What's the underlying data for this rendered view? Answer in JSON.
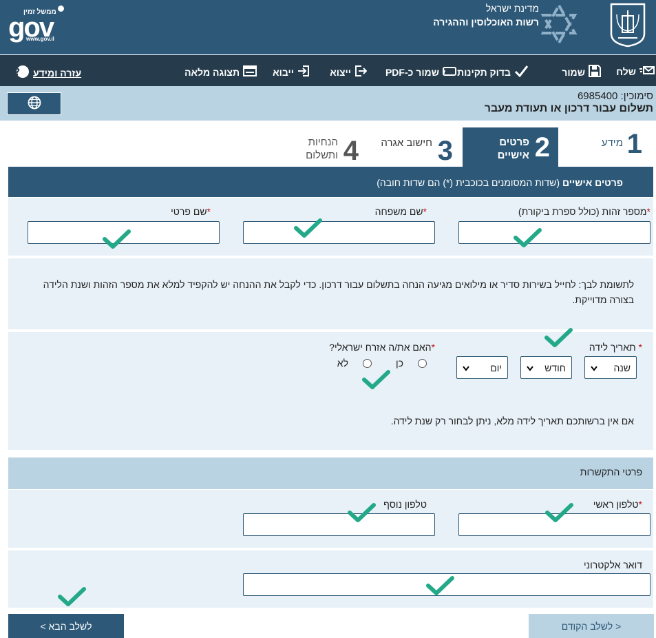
{
  "header": {
    "state_name": "מדינת ישראל",
    "authority_name": "רשות האוכלוסין וההגירה",
    "gov_logo_tagline": "ממשל זמין",
    "gov_logo_text": "gov",
    "gov_logo_url": "www.gov.il"
  },
  "toolbar": {
    "send": "שלח",
    "save": "שמור",
    "check_validity": "בדוק תקינות",
    "save_pdf": "שמור כ-PDF",
    "export": "ייצוא",
    "import": "ייבוא",
    "full_view": "תצוגה מלאה",
    "help": "עזרה ומידע"
  },
  "form": {
    "reference_label": "סימוכין:",
    "reference_number": "6985400",
    "title": "תשלום עבור דרכון או תעודת מעבר"
  },
  "steps": [
    {
      "num": "1",
      "label": "מידע"
    },
    {
      "num": "2",
      "label": "פרטים אישיים",
      "active": true
    },
    {
      "num": "3",
      "label": "חישוב אגרה"
    },
    {
      "num": "4",
      "label": "הנחיות ותשלום"
    }
  ],
  "personal": {
    "section_title": "פרטים אישיים",
    "section_note": "(שדות המסומנים בכוכבית (*) הם שדות חובה)",
    "required_mark": "*",
    "id_label": "מספר זהות (כולל ספרת ביקורת)",
    "last_name_label": "שם משפחה",
    "first_name_label": "שם פרטי",
    "notice": "לתשומת לבך: לחייל בשירות סדיר או מילואים מגיעה הנחה בתשלום עבור דרכון. כדי לקבל את ההנחה יש להקפיד למלא את מספר הזהות ושנת הלידה בצורה מדוייקת.",
    "birth_date_label": "תאריך לידה",
    "year_placeholder": "שנה",
    "month_placeholder": "חודש",
    "day_placeholder": "יום",
    "citizen_question": "האם את/ה אזרח ישראלי?",
    "yes": "כן",
    "no": "לא",
    "birth_note": "אם אין ברשותכם תאריך לידה מלא, ניתן לבחור רק שנת לידה."
  },
  "contact": {
    "section_title": "פרטי התקשרות",
    "main_phone_label": "טלפון ראשי",
    "extra_phone_label": "טלפון נוסף",
    "email_label": "דואר אלקטרוני"
  },
  "nav": {
    "prev": "< לשלב הקודם",
    "next": "לשלב הבא >"
  },
  "colors": {
    "header_bg": "#2d5877",
    "toolbar_bg": "#263c4c",
    "light_blue": "#b9d3e3",
    "panel_bg": "#e8f1f7",
    "check_green": "#23a989"
  }
}
